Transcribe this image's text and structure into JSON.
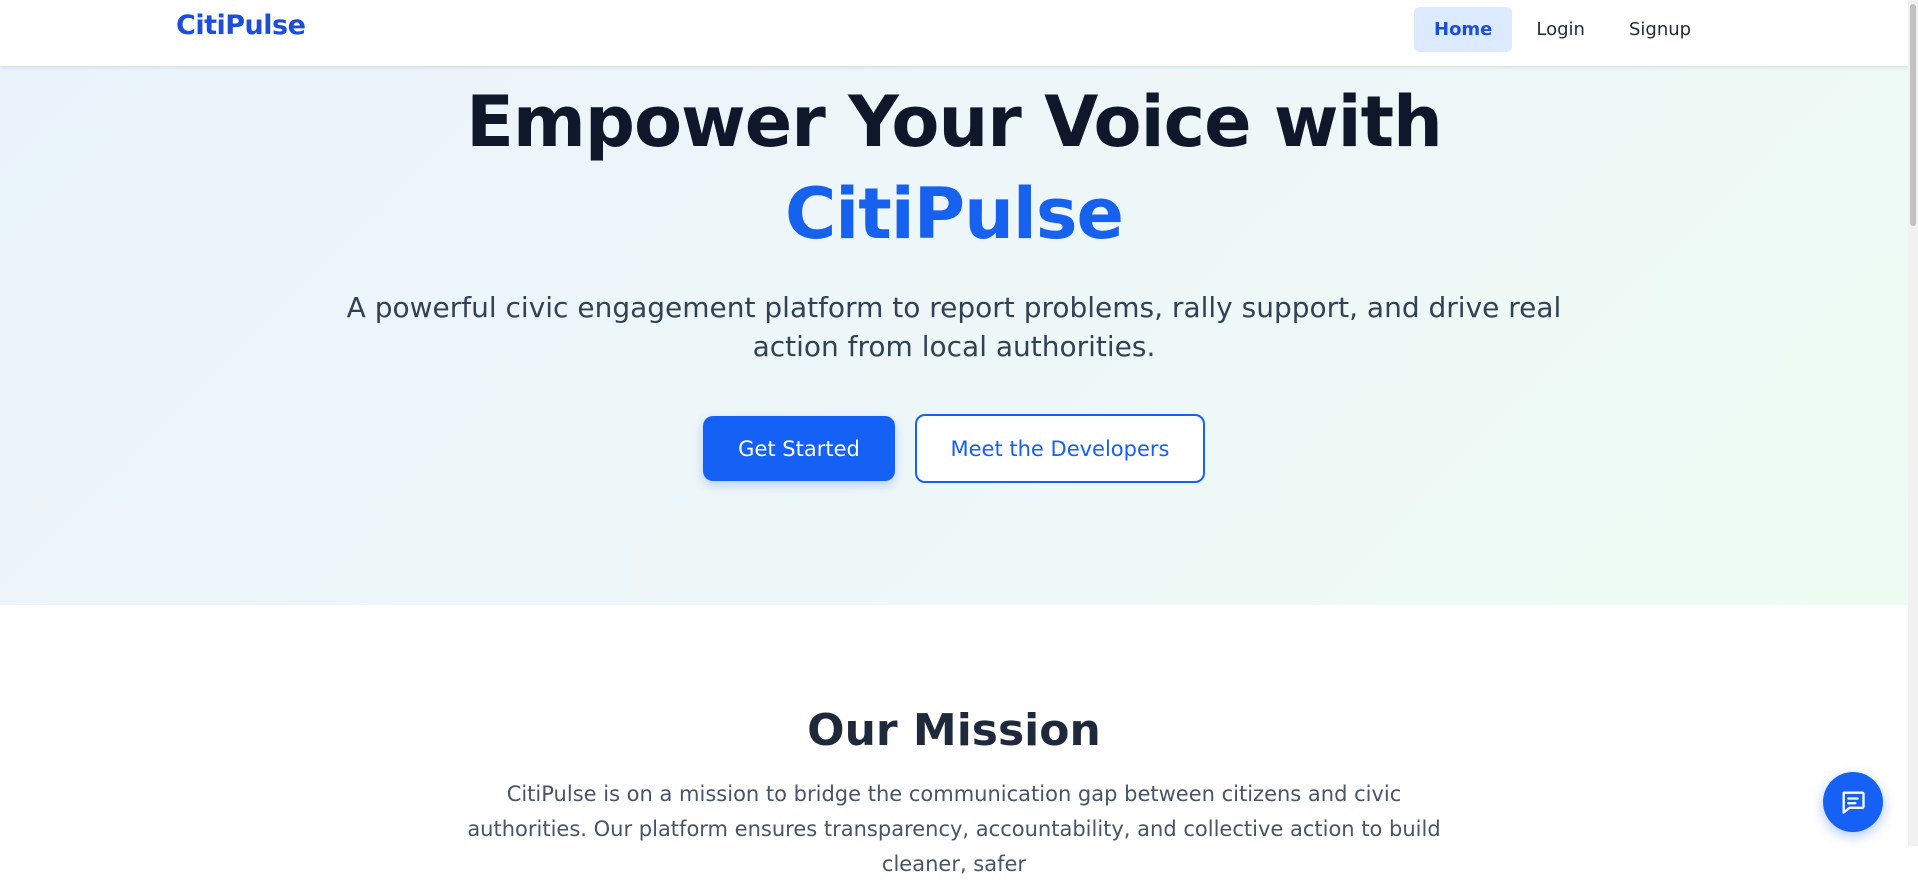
{
  "nav": {
    "brand": "CitiPulse",
    "links": [
      {
        "label": "Home",
        "active": true
      },
      {
        "label": "Login",
        "active": false
      },
      {
        "label": "Signup",
        "active": false
      }
    ]
  },
  "hero": {
    "title_line1": "Empower Your Voice with",
    "title_accent": "CitiPulse",
    "subtitle": "A powerful civic engagement platform to report problems, rally support, and drive real action from local authorities.",
    "primary_button": "Get Started",
    "secondary_button": "Meet the Developers"
  },
  "mission": {
    "title": "Our Mission",
    "text": "CitiPulse is on a mission to bridge the communication gap between citizens and civic authorities. Our platform ensures transparency, accountability, and collective action to build cleaner, safer"
  },
  "chat": {
    "icon": "chat-icon"
  },
  "colors": {
    "brand": "#1d4ed8",
    "accent": "#1561f5",
    "nav_active_bg": "#dbeafe",
    "heading": "#0f172a"
  }
}
